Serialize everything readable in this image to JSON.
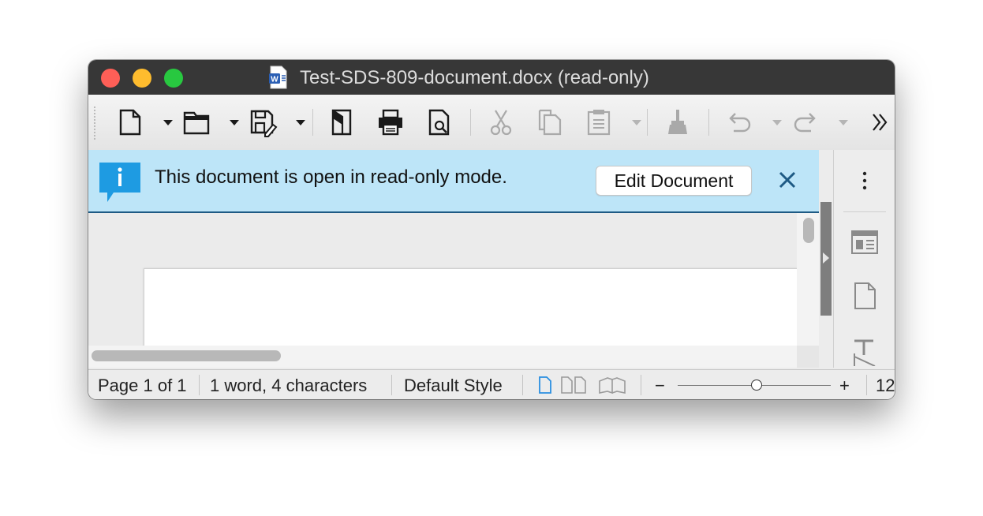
{
  "window": {
    "title": "Test-SDS-809-document.docx (read-only)",
    "title_icon": "word-document-icon"
  },
  "toolbar": {
    "items": [
      {
        "name": "new-document",
        "icon": "new-page-icon",
        "has_dropdown": true,
        "enabled": true
      },
      {
        "name": "open",
        "icon": "folder-icon",
        "has_dropdown": true,
        "enabled": true
      },
      {
        "name": "save",
        "icon": "save-edit-icon",
        "has_dropdown": true,
        "enabled": true
      },
      {
        "name": "export-pdf",
        "icon": "export-pdf-icon",
        "enabled": true
      },
      {
        "name": "print",
        "icon": "printer-icon",
        "enabled": true
      },
      {
        "name": "print-preview",
        "icon": "print-preview-icon",
        "enabled": true
      },
      {
        "name": "cut",
        "icon": "scissors-icon",
        "enabled": false
      },
      {
        "name": "copy",
        "icon": "copy-icon",
        "enabled": false
      },
      {
        "name": "paste",
        "icon": "clipboard-icon",
        "has_dropdown": true,
        "enabled": false
      },
      {
        "name": "clone-formatting",
        "icon": "paintbrush-icon",
        "enabled": false
      },
      {
        "name": "undo",
        "icon": "undo-icon",
        "has_dropdown": true,
        "enabled": false
      },
      {
        "name": "redo",
        "icon": "redo-icon",
        "has_dropdown": true,
        "enabled": false
      },
      {
        "name": "more",
        "icon": "double-chevron-right-icon",
        "enabled": true
      }
    ]
  },
  "infobar": {
    "message": "This document is open in read-only mode.",
    "edit_button_label": "Edit Document",
    "background": "#bde5f8",
    "accent": "#1e5a84"
  },
  "sidebar": {
    "items": [
      {
        "name": "menu",
        "icon": "vertical-ellipsis-icon"
      },
      {
        "name": "properties",
        "icon": "properties-panel-icon"
      },
      {
        "name": "page",
        "icon": "page-icon"
      },
      {
        "name": "styles",
        "icon": "styles-icon"
      }
    ]
  },
  "statusbar": {
    "page": "Page 1 of 1",
    "word_count": "1 word, 4 characters",
    "page_style": "Default Style",
    "zoom_minus": "−",
    "zoom_plus": "+",
    "zoom_value_partial": "12"
  }
}
